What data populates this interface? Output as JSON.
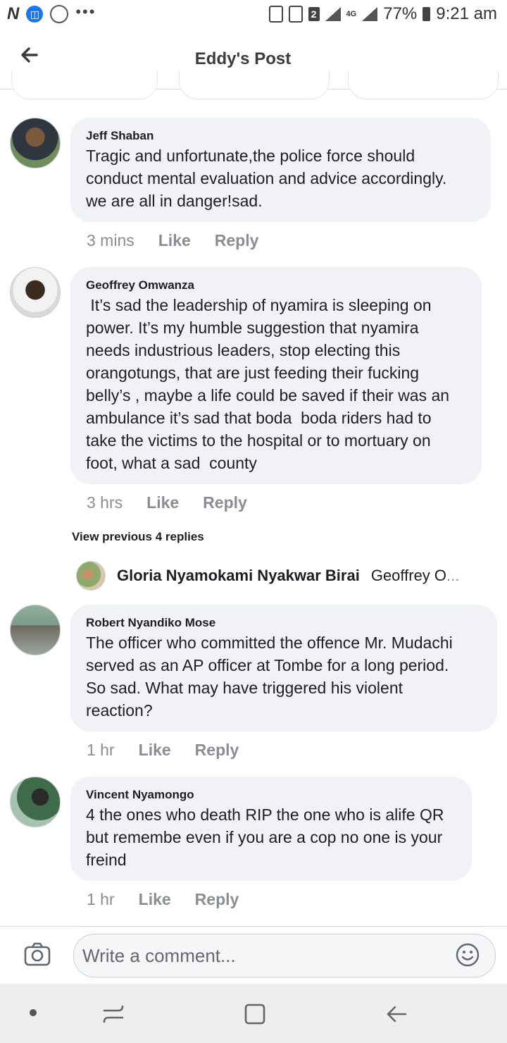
{
  "status_bar": {
    "left_icons": [
      "n-icon",
      "app-badge-icon",
      "whatsapp-icon",
      "more-dots-icon"
    ],
    "sim_badge": "2",
    "network": "4G",
    "battery": "77%",
    "time": "9:21 am"
  },
  "header": {
    "title": "Eddy's Post"
  },
  "comments": [
    {
      "name": "Jeff Shaban",
      "text": "Tragic and unfortunate,the police force should\nconduct mental evaluation and advice accordingly.\nwe are all in danger!sad.",
      "time": "3 mins",
      "like": "Like",
      "reply": "Reply"
    },
    {
      "name": "Geoffrey Omwanza",
      "text": " It’s sad the leadership of nyamira is sleeping on\npower. It’s my humble suggestion that nyamira\nneeds industrious leaders, stop electing this\norangotungs, that are just feeding their fucking\nbelly’s , maybe a life could be saved if their was an\nambulance it’s sad that boda  boda riders had to\ntake the victims to the hospital or to mortuary on\nfoot, what a sad  county",
      "time": "3 hrs",
      "like": "Like",
      "reply": "Reply"
    },
    {
      "name": "Robert Nyandiko Mose",
      "text": "The officer who committed the offence Mr. Mudachi\nserved as an AP officer at Tombe for a long period.\nSo sad. What may have triggered his violent\nreaction?",
      "time": "1 hr",
      "like": "Like",
      "reply": "Reply"
    },
    {
      "name": "Vincent Nyamongo",
      "text": "4 the ones who death RIP the one who is alife QR\nbut remembe even if you are a cop no one is your\nfreind",
      "time": "1 hr",
      "like": "Like",
      "reply": "Reply"
    }
  ],
  "replies": {
    "view_previous": "View previous 4 replies",
    "latest_name": "Gloria Nyamokami Nyakwar Birai",
    "latest_preview": "Geoffrey O",
    "ellipsis": "..."
  },
  "composer": {
    "placeholder": "Write a comment..."
  },
  "colors": {
    "bubble": "#f0f2f5",
    "meta_text": "#8a8d91",
    "accent": "#1877f2",
    "navbar": "#eeeeee"
  }
}
